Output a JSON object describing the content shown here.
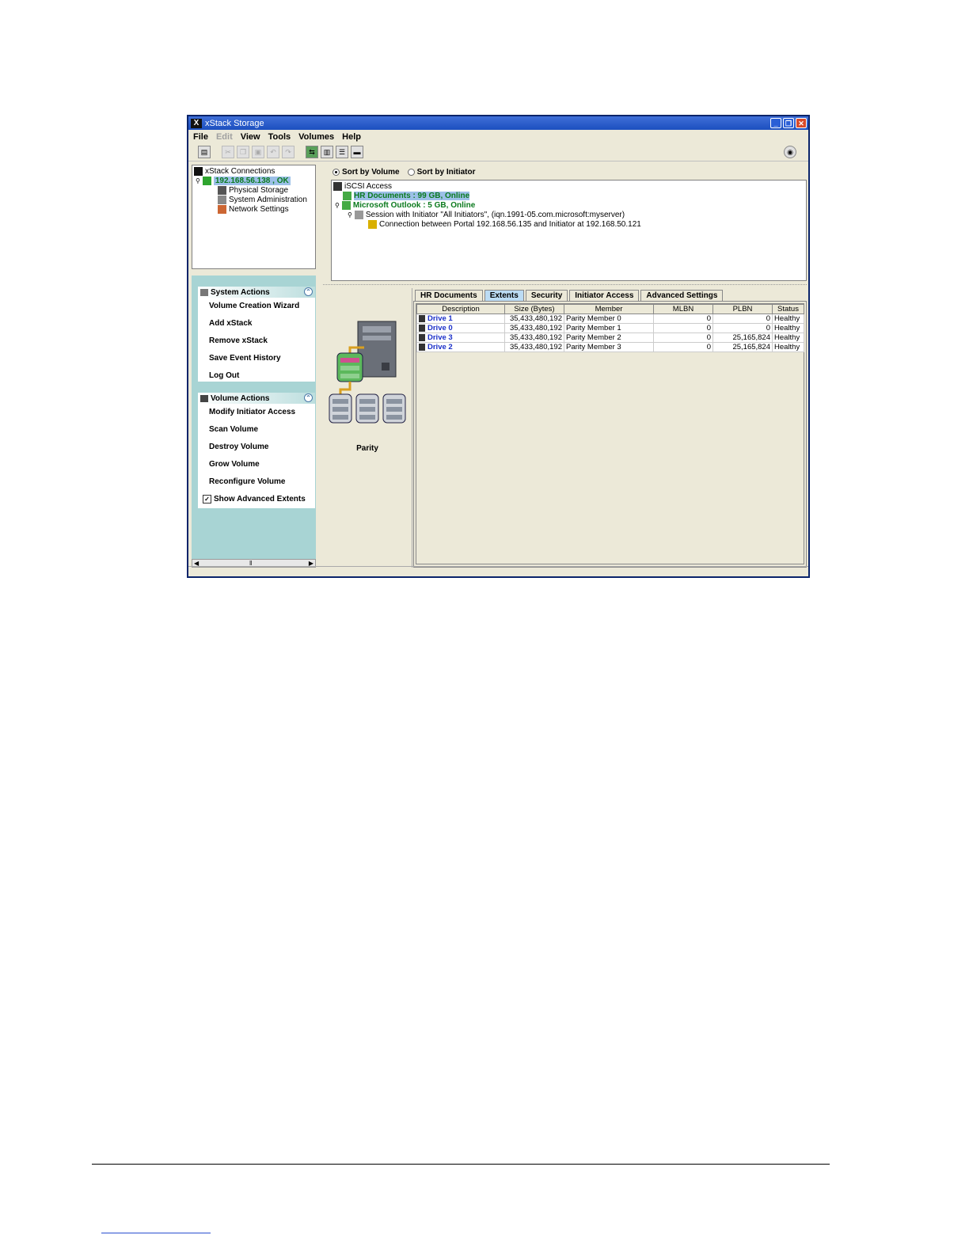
{
  "window": {
    "title": "xStack Storage",
    "logo": "X"
  },
  "menu": [
    {
      "label": "File",
      "enabled": true
    },
    {
      "label": "Edit",
      "enabled": false
    },
    {
      "label": "View",
      "enabled": true
    },
    {
      "label": "Tools",
      "enabled": true
    },
    {
      "label": "Volumes",
      "enabled": true
    },
    {
      "label": "Help",
      "enabled": true
    }
  ],
  "tree": {
    "root": "xStack Connections",
    "connection": "192.168.56.138 , OK",
    "children": [
      "Physical Storage",
      "System Administration",
      "Network Settings"
    ]
  },
  "system_actions": {
    "title": "System Actions",
    "items": [
      "Volume Creation Wizard",
      "Add xStack",
      "Remove xStack",
      "Save Event History",
      "Log Out"
    ]
  },
  "volume_actions": {
    "title": "Volume Actions",
    "items": [
      "Modify Initiator Access",
      "Scan Volume",
      "Destroy Volume",
      "Grow Volume",
      "Reconfigure Volume"
    ],
    "checkbox_label": "Show Advanced Extents",
    "checkbox_checked": true
  },
  "sort": {
    "by_volume": "Sort by Volume",
    "by_initiator": "Sort by Initiator",
    "selected": "volume"
  },
  "iscsi": {
    "root": "iSCSI Access",
    "volumes": [
      "HR Documents : 99 GB, Online",
      "Microsoft Outlook : 5 GB, Online"
    ],
    "session": "Session with Initiator \"All Initiators\", (iqn.1991-05.com.microsoft:myserver)",
    "connection": "Connection between Portal 192.168.56.135 and Initiator at  192.168.50.121"
  },
  "parity_label": "Parity",
  "tabs": [
    "HR Documents",
    "Extents",
    "Security",
    "Initiator Access",
    "Advanced Settings"
  ],
  "active_tab": "Extents",
  "table": {
    "columns": [
      "Description",
      "Size (Bytes)",
      "Member",
      "MLBN",
      "PLBN",
      "Status"
    ],
    "rows": [
      [
        "Drive 1",
        "35,433,480,192",
        "Parity Member 0",
        "0",
        "0",
        "Healthy"
      ],
      [
        "Drive 0",
        "35,433,480,192",
        "Parity Member 1",
        "0",
        "0",
        "Healthy"
      ],
      [
        "Drive 3",
        "35,433,480,192",
        "Parity Member 2",
        "0",
        "25,165,824",
        "Healthy"
      ],
      [
        "Drive 2",
        "35,433,480,192",
        "Parity Member 3",
        "0",
        "25,165,824",
        "Healthy"
      ]
    ]
  }
}
